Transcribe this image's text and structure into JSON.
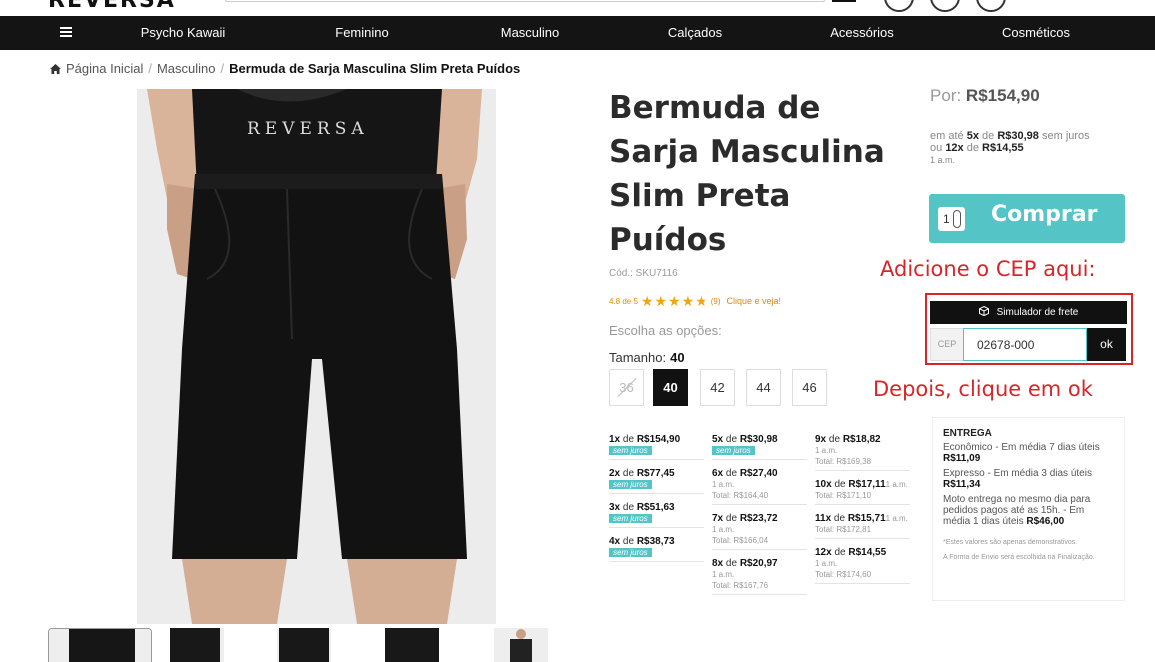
{
  "header": {
    "logo": "REVERSA"
  },
  "nav": {
    "items": [
      "Psycho Kawaii",
      "Feminino",
      "Masculino",
      "Calçados",
      "Acessórios",
      "Cosméticos"
    ]
  },
  "breadcrumb": {
    "home": "Página Inicial",
    "category": "Masculino",
    "current": "Bermuda de Sarja Masculina Slim Preta Puídos"
  },
  "photo": {
    "shirt_print": "REVERSA"
  },
  "product": {
    "title": "Bermuda de Sarja Masculina Slim Preta Puídos",
    "sku": "Cód.: SKU7116",
    "rating_text": "4.8 de 5",
    "rating_value": 4.8,
    "rating_count": "(9)",
    "rating_link": "Clique e veja!",
    "options_label": "Escolha as opções:",
    "size_label": "Tamanho:",
    "size_selected": "40",
    "sizes": [
      {
        "label": "36",
        "state": "unavailable"
      },
      {
        "label": "40",
        "state": "selected"
      },
      {
        "label": "42",
        "state": "available"
      },
      {
        "label": "44",
        "state": "available"
      },
      {
        "label": "46",
        "state": "available"
      }
    ]
  },
  "installments": {
    "col1": [
      {
        "n": "1x",
        "de": "de",
        "value": "R$154,90",
        "badge": "sem juros"
      },
      {
        "n": "2x",
        "de": "de",
        "value": "R$77,45",
        "badge": "sem juros"
      },
      {
        "n": "3x",
        "de": "de",
        "value": "R$51,63",
        "badge": "sem juros"
      },
      {
        "n": "4x",
        "de": "de",
        "value": "R$38,73",
        "badge": "sem juros"
      }
    ],
    "col2": [
      {
        "n": "5x",
        "de": "de",
        "value": "R$30,98",
        "badge": "sem juros"
      },
      {
        "n": "6x",
        "de": "de",
        "value": "R$27,40",
        "am": "1 a.m.",
        "total": "Total: R$164,40"
      },
      {
        "n": "7x",
        "de": "de",
        "value": "R$23,72",
        "am": "1 a.m.",
        "total": "Total: R$166,04"
      },
      {
        "n": "8x",
        "de": "de",
        "value": "R$20,97",
        "am": "1 a.m.",
        "total": "Total: R$167,76"
      }
    ],
    "col3": [
      {
        "n": "9x",
        "de": "de",
        "value": "R$18,82",
        "am": "1 a.m.",
        "total": "Total: R$169,38"
      },
      {
        "n": "10x",
        "de": "de",
        "value": "R$17,11",
        "inline_am": "1 a.m.",
        "total": "Total: R$171,10"
      },
      {
        "n": "11x",
        "de": "de",
        "value": "R$15,71",
        "inline_am": "1 a.m.",
        "total": "Total: R$172,81"
      },
      {
        "n": "12x",
        "de": "de",
        "value": "R$14,55",
        "am": "1 a.m.",
        "total": "Total: R$174,60"
      }
    ]
  },
  "price": {
    "por_label": "Por:",
    "price": "R$154,90",
    "line1_pre": "em até",
    "line1_n": "5x",
    "line1_de": "de",
    "line1_value": "R$30,98",
    "line1_post": "sem juros",
    "line2_pre": "ou",
    "line2_n": "12x",
    "line2_de": "de",
    "line2_value": "R$14,55",
    "line2_am": "1 a.m."
  },
  "buy": {
    "qty": "1",
    "label": "Comprar"
  },
  "annotations": {
    "cep_hint": "Adicione o CEP aqui:",
    "ok_hint": "Depois, clique em ok"
  },
  "frete": {
    "title": "Simulador de frete",
    "cep_label": "CEP",
    "cep_value": "02678-000",
    "ok_label": "ok"
  },
  "entrega": {
    "heading": "ENTREGA",
    "economico": "Econômico - Em média 7 dias úteis",
    "economico_price": "R$11,09",
    "expresso": "Expresso - Em média 3 dias úteis",
    "expresso_price": "R$11,34",
    "moto": "Moto entrega no mesmo dia para pedidos pagos até as 15h. - Em média 1 dias úteis",
    "moto_price": "R$46,00",
    "disclaimer1": "*Estes valores são apenas demonstrativos.",
    "disclaimer2": "A Forma de Envio será escolhida na Finalização."
  },
  "colors": {
    "accent": "#54c4c7",
    "nav_bg": "#141414",
    "annotation": "#d9252a",
    "star": "#f2a60b"
  }
}
